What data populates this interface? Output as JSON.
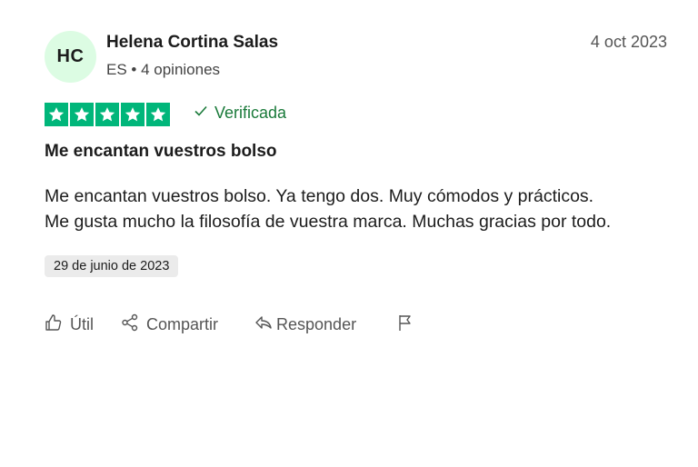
{
  "review": {
    "avatar_initials": "HC",
    "reviewer_name": "Helena Cortina Salas",
    "reviewer_meta": "ES • 4 opiniones",
    "review_date": "4 oct 2023",
    "rating": 5,
    "rating_max": 5,
    "star_color": "#00b67a",
    "verified_label": "Verificada",
    "title": "Me encantan vuestros bolso",
    "body_lines": [
      "Me encantan vuestros bolso. Ya tengo dos. Muy cómodos y prácticos.",
      "Me gusta mucho la filosofía de vuestra marca. Muchas gracias por todo."
    ],
    "experience_date": "29 de junio de 2023"
  },
  "actions": {
    "useful_label": "Útil",
    "share_label": "Compartir",
    "reply_label": "Responder",
    "icons": [
      "thumbs-up-icon",
      "share-icon",
      "reply-icon",
      "flag-icon"
    ]
  }
}
